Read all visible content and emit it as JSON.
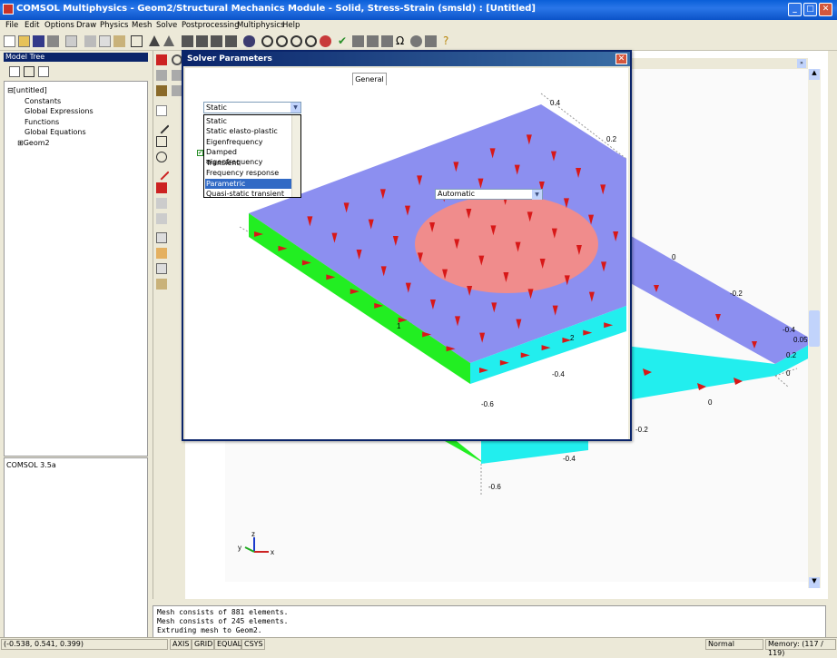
{
  "window": {
    "title": "COMSOL Multiphysics - Geom2/Structural Mechanics Module - Solid, Stress-Strain (smsld) : [Untitled]"
  },
  "menu": [
    "File",
    "Edit",
    "Options",
    "Draw",
    "Physics",
    "Mesh",
    "Solve",
    "Postprocessing",
    "Multiphysics",
    "Help"
  ],
  "model_tree": {
    "header": "Model Tree",
    "items": [
      "[untitled]",
      "Constants",
      "Global Expressions",
      "Functions",
      "Global Equations",
      "Geom2"
    ]
  },
  "version": "COMSOL 3.5a",
  "dialog": {
    "title": "Solver Parameters",
    "tab": "General",
    "analysis_value": "Static",
    "analysis_options": [
      "Static",
      "Static elasto-plastic",
      "Eigenfrequency",
      "Damped eigenfrequency",
      "Transient",
      "Frequency response",
      "Parametric",
      "Quasi-static transient"
    ],
    "selected_option": "Parametric",
    "solver_value": "Automatic"
  },
  "plot": {
    "labels_front": [
      "0.4",
      "0.2",
      "0",
      "-0.2",
      "-0.4",
      "-0.6",
      "1",
      "2"
    ],
    "labels_back": [
      "0",
      "-0.2",
      "-0.4",
      "-0.2",
      "-0.4",
      "-0.6",
      "0",
      "0.05",
      "0.2",
      "0",
      "-0.2"
    ],
    "axis_x": "x",
    "axis_y": "y",
    "axis_z": "z"
  },
  "log": [
    "Mesh consists of 881 elements.",
    "Mesh consists of 245 elements.",
    "Extruding mesh to Geom2."
  ],
  "status": {
    "coords": "(-0.538, 0.541, 0.399)",
    "toggles": [
      "AXIS",
      "GRID",
      "EQUAL",
      "CSYS"
    ],
    "mode": "Normal",
    "memory": "Memory: (117 / 119)"
  },
  "colors": {
    "title_blue": "#0a5fd8",
    "top_face": "#8c8ff0",
    "circle": "#f08c8c",
    "side_green": "#22ee22",
    "side_cyan": "#22eeee",
    "arrow_red": "#d81818"
  }
}
